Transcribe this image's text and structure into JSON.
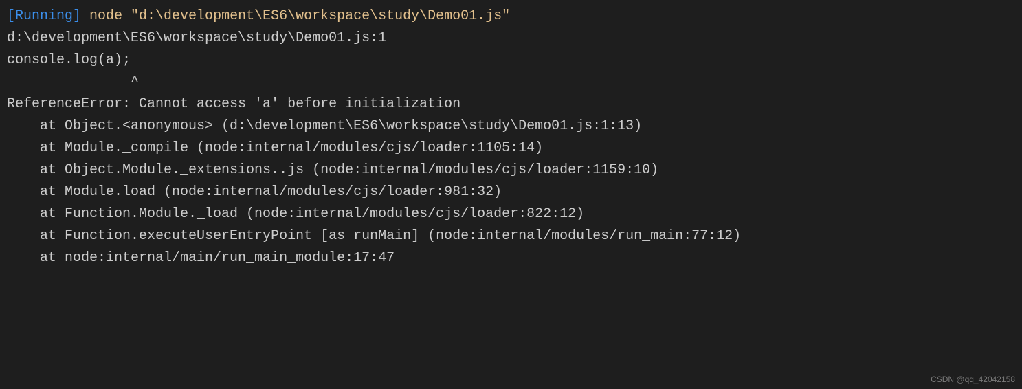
{
  "terminal": {
    "running_prefix": "[Running]",
    "command": " node \"d:\\development\\ES6\\workspace\\study\\Demo01.js\"",
    "error_location": "d:\\development\\ES6\\workspace\\study\\Demo01.js:1",
    "error_code": "console.log(a);",
    "caret_line": "               ^",
    "blank": "",
    "error_message": "ReferenceError: Cannot access 'a' before initialization",
    "stack": [
      "    at Object.<anonymous> (d:\\development\\ES6\\workspace\\study\\Demo01.js:1:13)",
      "    at Module._compile (node:internal/modules/cjs/loader:1105:14)",
      "    at Object.Module._extensions..js (node:internal/modules/cjs/loader:1159:10)",
      "    at Module.load (node:internal/modules/cjs/loader:981:32)",
      "    at Function.Module._load (node:internal/modules/cjs/loader:822:12)",
      "    at Function.executeUserEntryPoint [as runMain] (node:internal/modules/run_main:77:12)",
      "    at node:internal/main/run_main_module:17:47"
    ]
  },
  "watermark": "CSDN @qq_42042158"
}
